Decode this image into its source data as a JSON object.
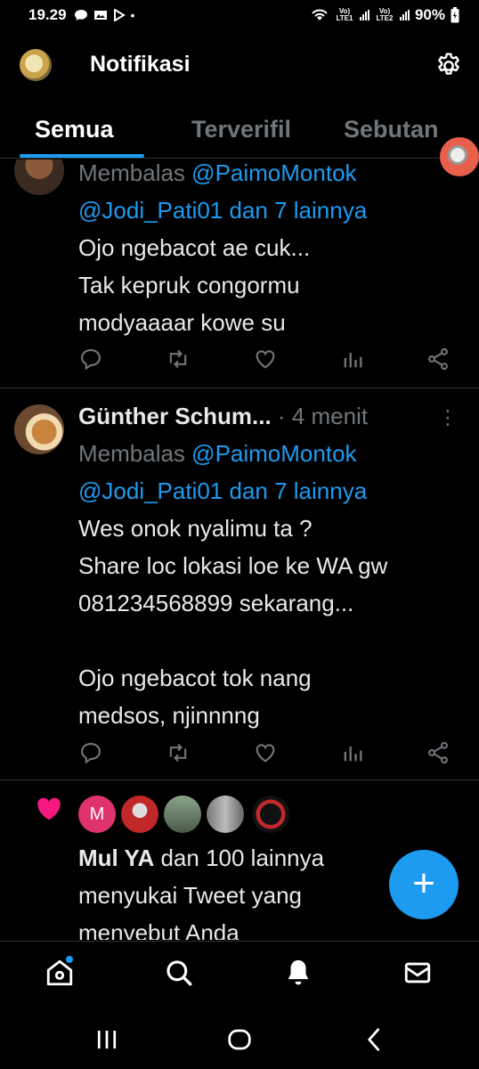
{
  "status_bar": {
    "time": "19.29",
    "lte1": "Vo) LTE1",
    "lte2": "Vo) LTE2",
    "battery": "90%"
  },
  "header": {
    "title": "Notifikasi"
  },
  "tabs": [
    {
      "label": "Semua",
      "active": true
    },
    {
      "label": "Terverifil",
      "active": false
    },
    {
      "label": "Sebutan",
      "active": false
    }
  ],
  "tweets": [
    {
      "reply_prefix": "Membalas",
      "reply_to": "@PaimoMontok",
      "reply_line2": "@Jodi_Pati01 dan 7 lainnya",
      "text_lines": [
        "Ojo ngebacot ae cuk...",
        "Tak kepruk congormu",
        "modyaaaar kowe su"
      ]
    },
    {
      "name": "Günther Schum...",
      "time": "· 4 menit",
      "reply_prefix": "Membalas",
      "reply_to": "@PaimoMontok",
      "reply_line2": "@Jodi_Pati01 dan 7 lainnya",
      "text_lines": [
        "Wes onok nyalimu ta ?",
        "Share loc lokasi loe ke WA gw",
        "081234568899 sekarang...",
        "",
        "Ojo ngebacot tok nang",
        "medsos, njinnnng"
      ]
    }
  ],
  "like_notification": {
    "avatar_letter": "M",
    "actor": "Mul YA",
    "line1_rest": " dan 100 lainnya",
    "line2": "menyukai Tweet yang",
    "line3": "menyebut Anda"
  },
  "fab_label": "+",
  "colors": {
    "accent": "#1d9bf0",
    "like": "#f91880",
    "background": "#000000"
  }
}
